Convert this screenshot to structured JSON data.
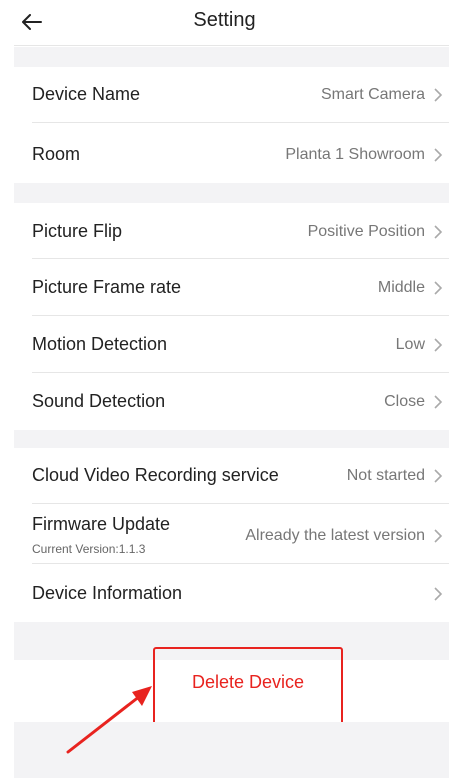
{
  "header": {
    "title": "Setting"
  },
  "groups": [
    [
      {
        "label": "Device Name",
        "value": "Smart Camera"
      },
      {
        "label": "Room",
        "value": "Planta 1 Showroom"
      }
    ],
    [
      {
        "label": "Picture Flip",
        "value": "Positive Position"
      },
      {
        "label": "Picture Frame rate",
        "value": "Middle"
      },
      {
        "label": "Motion Detection",
        "value": "Low"
      },
      {
        "label": "Sound Detection",
        "value": "Close"
      }
    ],
    [
      {
        "label": "Cloud Video Recording service",
        "value": "Not started"
      },
      {
        "label": "Firmware Update",
        "sub": "Current Version:1.1.3",
        "value": "Already the latest version"
      },
      {
        "label": "Device Information",
        "value": ""
      }
    ]
  ],
  "delete": {
    "label": "Delete Device"
  },
  "colors": {
    "accent_red": "#e8231f",
    "gap_gray": "#f3f3f5"
  }
}
